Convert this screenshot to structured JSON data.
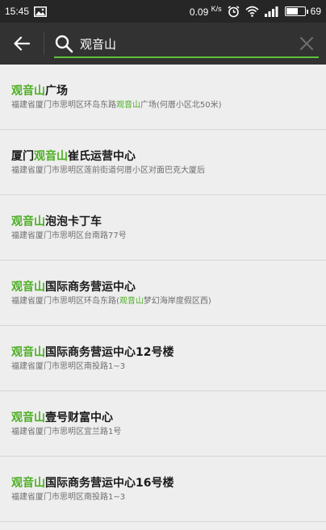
{
  "status_bar": {
    "time": "15:45",
    "network_speed": "0.09",
    "network_speed_unit": "K/s",
    "battery_level": "69"
  },
  "search": {
    "query": "观音山",
    "highlight_color": "#4cae22"
  },
  "results": [
    {
      "title": [
        {
          "t": "观音山",
          "hl": true
        },
        {
          "t": "广场",
          "hl": false
        }
      ],
      "address": [
        {
          "t": "福建省厦门市思明区环岛东路",
          "hl": false
        },
        {
          "t": "观音山",
          "hl": true
        },
        {
          "t": "广场(何厝小区北50米)",
          "hl": false
        }
      ]
    },
    {
      "title": [
        {
          "t": "厦门",
          "hl": false
        },
        {
          "t": "观音山",
          "hl": true
        },
        {
          "t": "崔氏运营中心",
          "hl": false
        }
      ],
      "address": [
        {
          "t": "福建省厦门市思明区莲前街道何厝小区对面巴克大厦后",
          "hl": false
        }
      ]
    },
    {
      "title": [
        {
          "t": "观音山",
          "hl": true
        },
        {
          "t": "泡泡卡丁车",
          "hl": false
        }
      ],
      "address": [
        {
          "t": "福建省厦门市思明区台南路77号",
          "hl": false
        }
      ]
    },
    {
      "title": [
        {
          "t": "观音山",
          "hl": true
        },
        {
          "t": "国际商务营运中心",
          "hl": false
        }
      ],
      "address": [
        {
          "t": "福建省厦门市思明区环岛东路(",
          "hl": false
        },
        {
          "t": "观音山",
          "hl": true
        },
        {
          "t": "梦幻海岸度假区西)",
          "hl": false
        }
      ]
    },
    {
      "title": [
        {
          "t": "观音山",
          "hl": true
        },
        {
          "t": "国际商务营运中心12号楼",
          "hl": false
        }
      ],
      "address": [
        {
          "t": "福建省厦门市思明区南投路1~3",
          "hl": false
        }
      ]
    },
    {
      "title": [
        {
          "t": "观音山",
          "hl": true
        },
        {
          "t": "壹号财富中心",
          "hl": false
        }
      ],
      "address": [
        {
          "t": "福建省厦门市思明区宜兰路1号",
          "hl": false
        }
      ]
    },
    {
      "title": [
        {
          "t": "观音山",
          "hl": true
        },
        {
          "t": "国际商务营运中心16号楼",
          "hl": false
        }
      ],
      "address": [
        {
          "t": "福建省厦门市思明区南投路1~3",
          "hl": false
        }
      ]
    }
  ]
}
